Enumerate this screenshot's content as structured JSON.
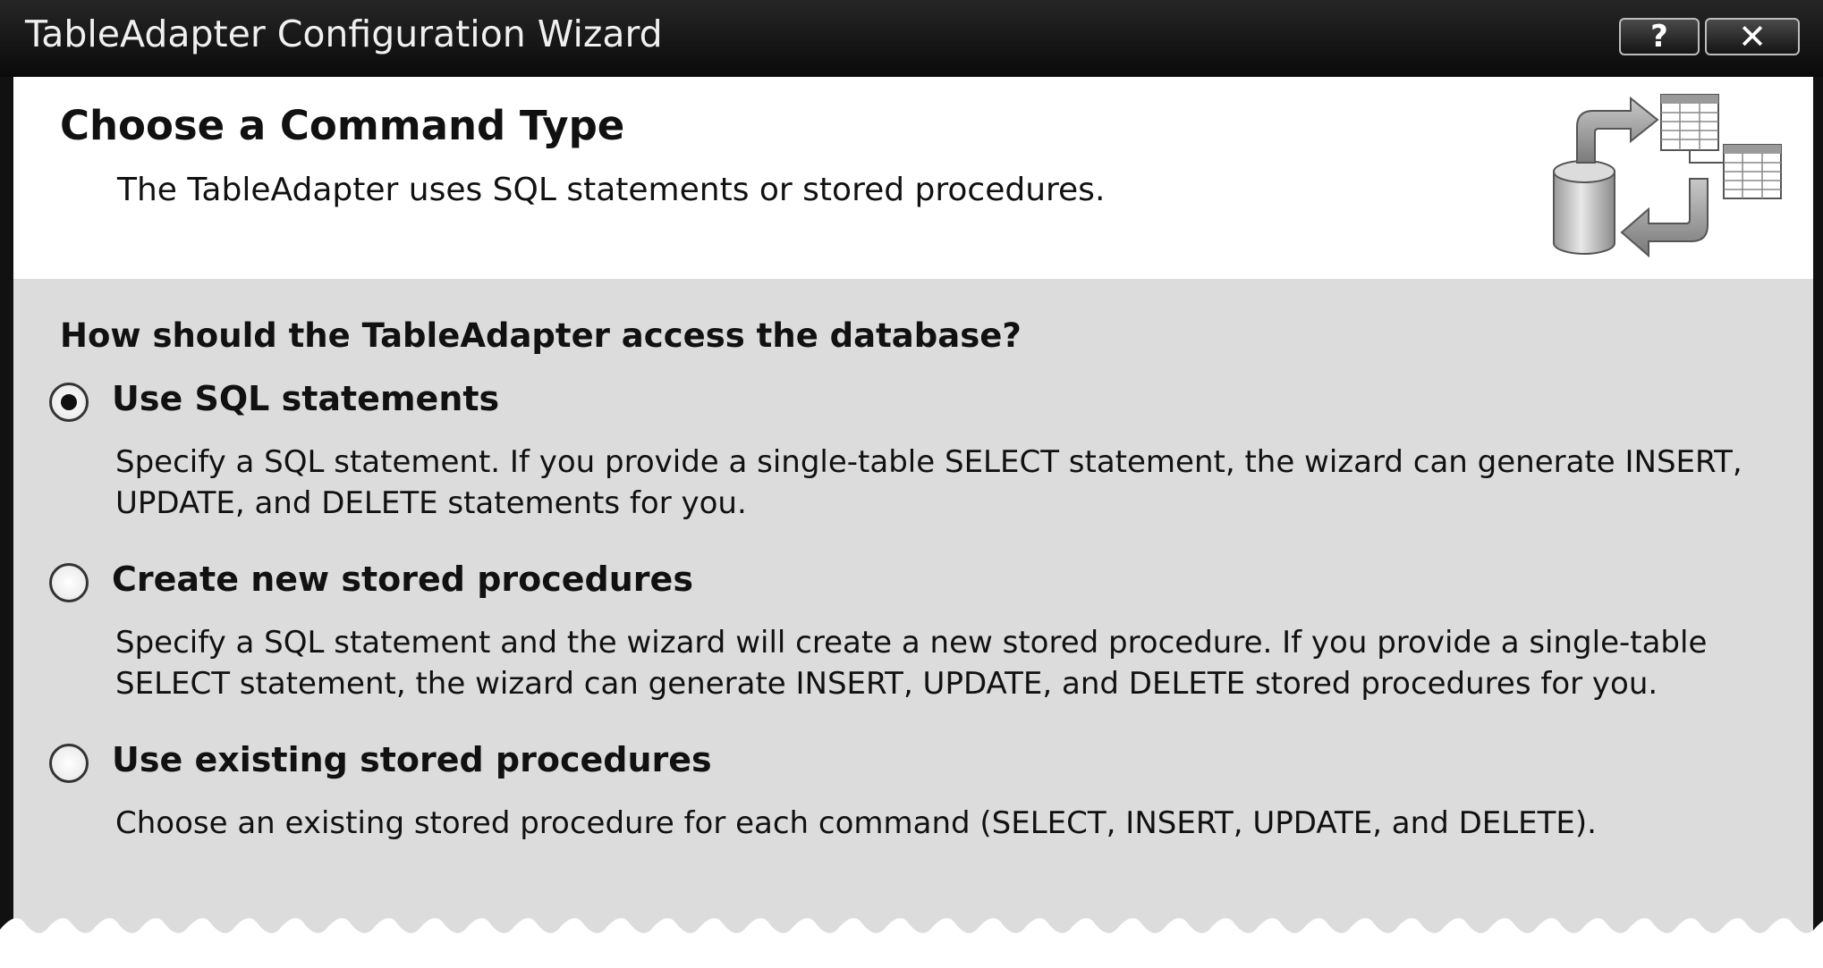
{
  "window": {
    "title": "TableAdapter Configuration Wizard",
    "help_label": "?",
    "close_label": "✕"
  },
  "header": {
    "title": "Choose a Command Type",
    "subtitle": "The TableAdapter uses SQL statements or stored procedures.",
    "icon": "database-table-flow-icon"
  },
  "body": {
    "question": "How should the TableAdapter access the database?",
    "options": [
      {
        "label": "Use SQL statements",
        "selected": true,
        "description": "Specify a SQL statement. If you provide a single-table SELECT statement, the wizard can generate INSERT, UPDATE, and DELETE statements for you."
      },
      {
        "label": "Create new stored procedures",
        "selected": false,
        "description": "Specify a SQL statement and the wizard will create a new stored procedure. If you provide a single-table SELECT statement, the wizard can generate INSERT, UPDATE, and DELETE stored procedures for you."
      },
      {
        "label": "Use existing stored procedures",
        "selected": false,
        "description": "Choose an existing stored procedure for each command (SELECT, INSERT, UPDATE, and DELETE)."
      }
    ]
  }
}
